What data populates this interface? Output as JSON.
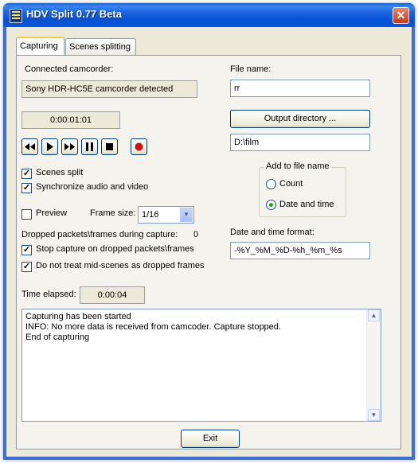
{
  "window": {
    "title": "HDV Split 0.77 Beta",
    "close_glyph": "✕"
  },
  "tabs": [
    {
      "label": "Capturing"
    },
    {
      "label": "Scenes splitting"
    }
  ],
  "camcorder": {
    "label": "Connected camcorder:",
    "value": "Sony HDR-HC5E camcorder detected"
  },
  "timecode": "0:00:01:01",
  "controls": {
    "rewind": "rewind-icon",
    "play": "play-icon",
    "fast_forward": "fast-forward-icon",
    "pause": "pause-icon",
    "stop": "stop-icon",
    "record": "record-icon",
    "record_color": "#cc1111"
  },
  "options": {
    "scenes_split": {
      "label": "Scenes split",
      "checked": true
    },
    "sync_av": {
      "label": "Synchronize audio and video",
      "checked": true
    },
    "preview": {
      "label": "Preview",
      "checked": false
    }
  },
  "frame_size": {
    "label": "Frame size:",
    "value": "1/16"
  },
  "dropped": {
    "label": "Dropped packets\\frames during capture:",
    "value": "0"
  },
  "stop_on_dropped": {
    "label": "Stop capture on dropped packets\\frames",
    "checked": true
  },
  "mid_scenes": {
    "label": "Do not treat mid-scenes as dropped frames",
    "checked": true
  },
  "elapsed": {
    "label": "Time elapsed:",
    "value": "0:00:04"
  },
  "file_name": {
    "label": "File name:",
    "value": "rr"
  },
  "output_dir": {
    "button": "Output directory ...",
    "value": "D:\\film"
  },
  "add_to_file_name": {
    "title": "Add to file name",
    "count": {
      "label": "Count",
      "selected": false
    },
    "date_time": {
      "label": "Date and time",
      "selected": true
    }
  },
  "date_format": {
    "label": "Date and time format:",
    "value": "-%Y_%M_%D-%h_%m_%s"
  },
  "log": {
    "lines": [
      "Capturing has been started",
      "INFO: No more data is received from camcoder. Capture stopped.",
      "End of capturing"
    ]
  },
  "exit_button": "Exit"
}
